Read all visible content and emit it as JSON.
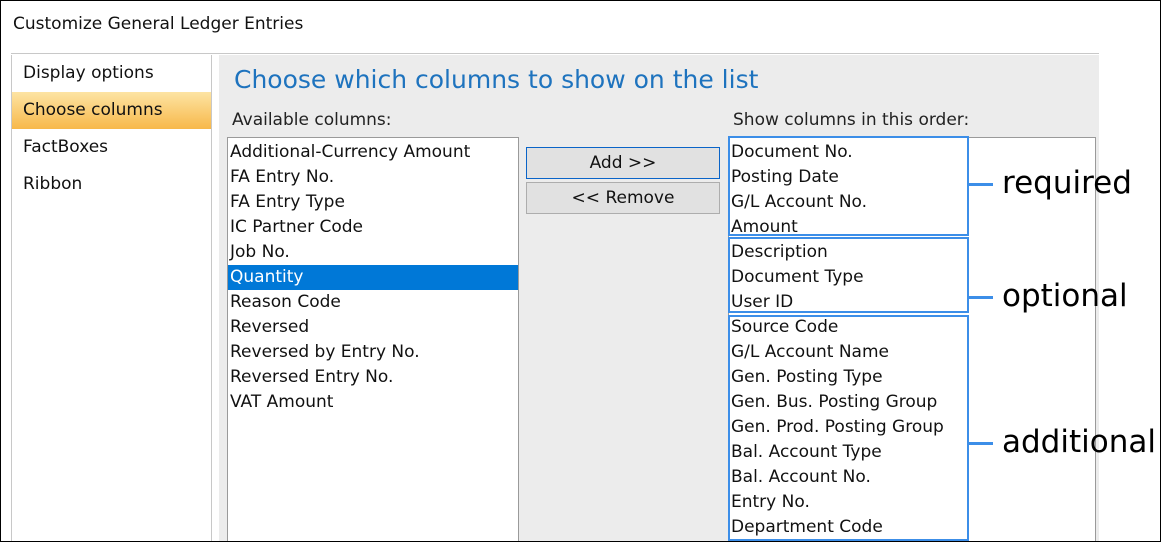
{
  "window": {
    "title": "Customize General Ledger Entries"
  },
  "nav": {
    "items": [
      {
        "label": "Display options",
        "selected": false
      },
      {
        "label": "Choose columns",
        "selected": true
      },
      {
        "label": "FactBoxes",
        "selected": false
      },
      {
        "label": "Ribbon",
        "selected": false
      }
    ]
  },
  "main": {
    "heading": "Choose which columns to show on the list",
    "available_label": "Available columns:",
    "show_label": "Show columns in this order:",
    "available_columns": [
      {
        "label": "Additional-Currency Amount",
        "selected": false
      },
      {
        "label": "FA Entry No.",
        "selected": false
      },
      {
        "label": "FA Entry Type",
        "selected": false
      },
      {
        "label": "IC Partner Code",
        "selected": false
      },
      {
        "label": "Job No.",
        "selected": false
      },
      {
        "label": "Quantity",
        "selected": true
      },
      {
        "label": "Reason Code",
        "selected": false
      },
      {
        "label": "Reversed",
        "selected": false
      },
      {
        "label": "Reversed by Entry No.",
        "selected": false
      },
      {
        "label": "Reversed Entry No.",
        "selected": false
      },
      {
        "label": "VAT Amount",
        "selected": false
      }
    ],
    "shown_columns": [
      "Document No.",
      "Posting Date",
      "G/L Account No.",
      "Amount",
      "Description",
      "Document Type",
      "User ID",
      "Source Code",
      "G/L Account Name",
      "Gen. Posting Type",
      "Gen. Bus. Posting Group",
      "Gen. Prod. Posting Group",
      "Bal. Account Type",
      "Bal. Account No.",
      "Entry No.",
      "Department Code"
    ],
    "add_label": "Add >>",
    "remove_label": "<< Remove"
  },
  "annotations": {
    "color": "#3c8ee8",
    "groups": [
      {
        "label": "required",
        "count": 4
      },
      {
        "label": "optional",
        "count": 3
      },
      {
        "label": "additional",
        "count": 9
      }
    ]
  }
}
